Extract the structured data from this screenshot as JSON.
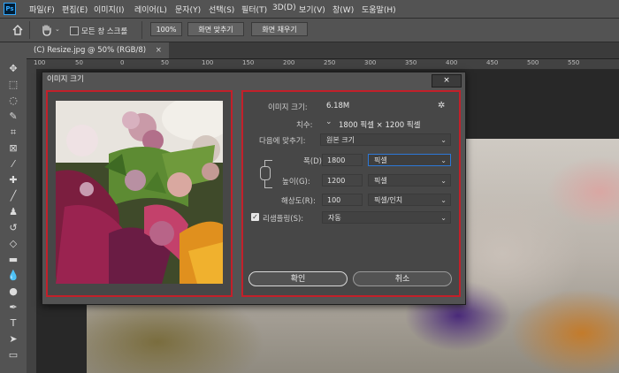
{
  "app": {
    "logo": "Ps"
  },
  "menu": [
    "파일(F)",
    "편집(E)",
    "이미지(I)",
    "레이어(L)",
    "문자(Y)",
    "선택(S)",
    "필터(T)",
    "3D(D)",
    "보기(V)",
    "창(W)",
    "도움말(H)"
  ],
  "options": {
    "home_icon": "home-icon",
    "hand_icon": "hand-icon",
    "scroll_all_label": "모든 창 스크롤",
    "zoom_value": "100%",
    "fit_screen_label": "화면 맞추기",
    "fill_screen_label": "화면 채우기"
  },
  "document": {
    "tab_label": "(C) Resize.jpg @ 50% (RGB/8)",
    "close_symbol": "×"
  },
  "ruler": {
    "ticks": [
      "100",
      "50",
      "0",
      "50",
      "100",
      "150",
      "200",
      "250",
      "300",
      "350",
      "400",
      "450",
      "500",
      "550"
    ]
  },
  "dialog": {
    "title": "이미지 크기",
    "close_symbol": "×",
    "image_size_label": "이미지 크기:",
    "image_size_value": "6.18M",
    "dimensions_label": "치수:",
    "dimensions_value": "1800 픽셀 × 1200 픽셀",
    "fit_to_label": "다음에 맞추기:",
    "fit_to_value": "원본 크기",
    "width_label": "폭(D):",
    "width_value": "1800",
    "width_unit": "픽셀",
    "height_label": "높이(G):",
    "height_value": "1200",
    "height_unit": "픽셀",
    "resolution_label": "해상도(R):",
    "resolution_value": "100",
    "resolution_unit": "픽셀/인치",
    "resample_label": "리샘플링(S):",
    "resample_checked": true,
    "resample_value": "자동",
    "ok_label": "확인",
    "cancel_label": "취소"
  },
  "colors": {
    "accent_focus": "#2d78d7",
    "highlight_frame": "#c3202a",
    "panel": "#535353"
  }
}
